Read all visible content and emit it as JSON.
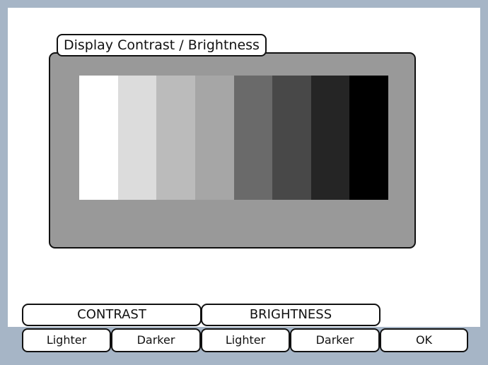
{
  "panel": {
    "title": "Display Contrast / Brightness",
    "swatch_colors": [
      "#ffffff",
      "#dcdcdc",
      "#bbbbbb",
      "#a6a6a6",
      "#6a6a6a",
      "#484848",
      "#252525",
      "#000000"
    ]
  },
  "tabs": {
    "contrast": "CONTRAST",
    "brightness": "BRIGHTNESS"
  },
  "softkeys": {
    "contrast_lighter": "Lighter",
    "contrast_darker": "Darker",
    "brightness_lighter": "Lighter",
    "brightness_darker": "Darker",
    "ok": "OK"
  },
  "colors": {
    "bezel": "#a6b5c6",
    "panel": "#999999",
    "outline": "#111111"
  }
}
